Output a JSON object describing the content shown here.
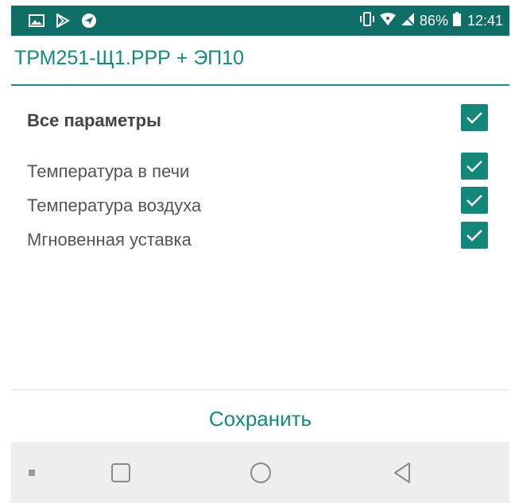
{
  "status_bar": {
    "icons_left": [
      "gallery-icon",
      "play-store-icon",
      "navigation-icon"
    ],
    "icons_right": [
      "vibrate-icon",
      "wifi-icon",
      "no-signal-icon",
      "battery-icon"
    ],
    "battery_percent": "86%",
    "time": "12:41",
    "background_color": "#0f6f66"
  },
  "header": {
    "title": "ТРМ251-Щ1.РРР + ЭП10",
    "accent_color": "#138a80"
  },
  "list": {
    "all_params": {
      "label": "Все параметры",
      "checked": true
    },
    "items": [
      {
        "label": "Температура в печи",
        "checked": true
      },
      {
        "label": "Температура воздуха",
        "checked": true
      },
      {
        "label": "Мгновенная уставка",
        "checked": true
      }
    ]
  },
  "footer": {
    "save_label": "Сохранить"
  },
  "nav_bar": {
    "items": [
      "menu-dot-icon",
      "recents-square-icon",
      "home-circle-icon",
      "back-triangle-icon"
    ],
    "background_color": "#eeeeee"
  }
}
